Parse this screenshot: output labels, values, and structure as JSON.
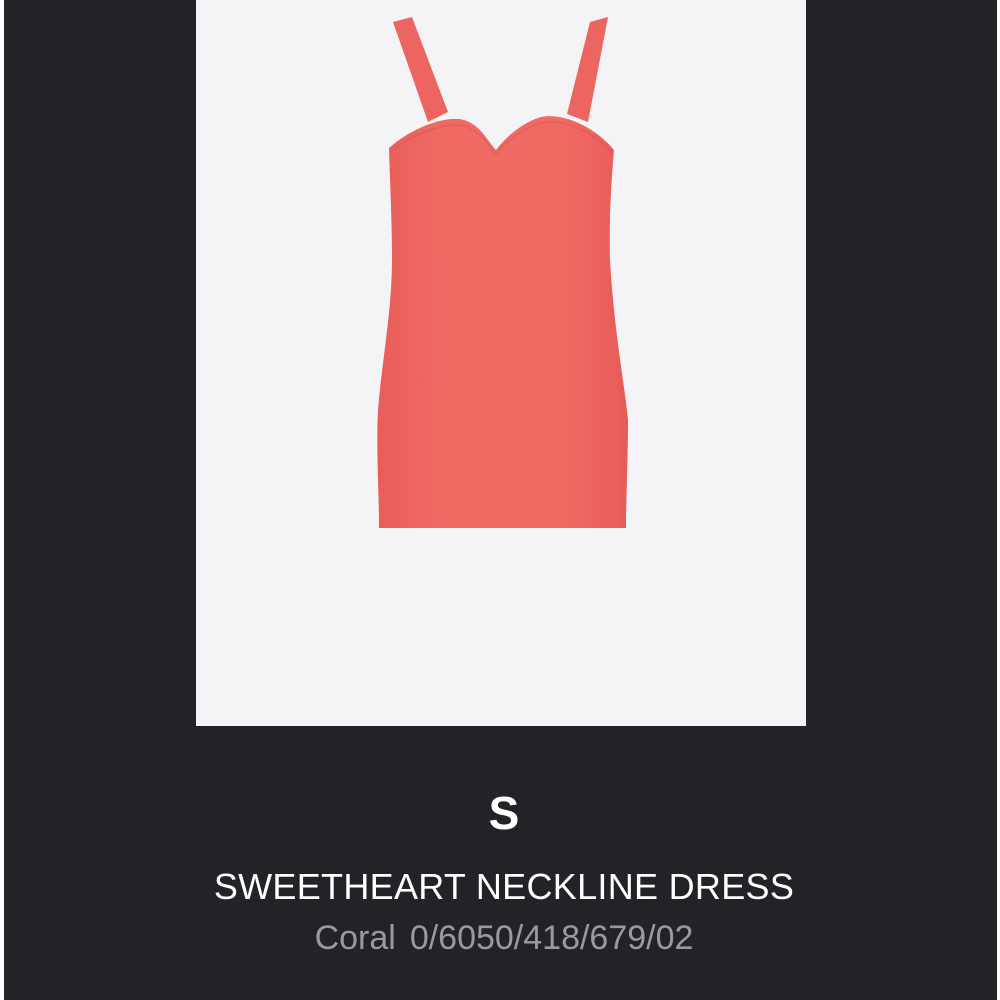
{
  "product": {
    "size": "S",
    "name": "SWEETHEART NECKLINE DRESS",
    "color_name": "Coral",
    "reference": "0/6050/418/679/02",
    "image": "coral-dress-image"
  },
  "colors": {
    "frame_background": "#222326",
    "image_background": "#f4f4f6",
    "dress": "#f06a64",
    "name_text": "#ffffff",
    "meta_text": "#9a9a9e"
  }
}
